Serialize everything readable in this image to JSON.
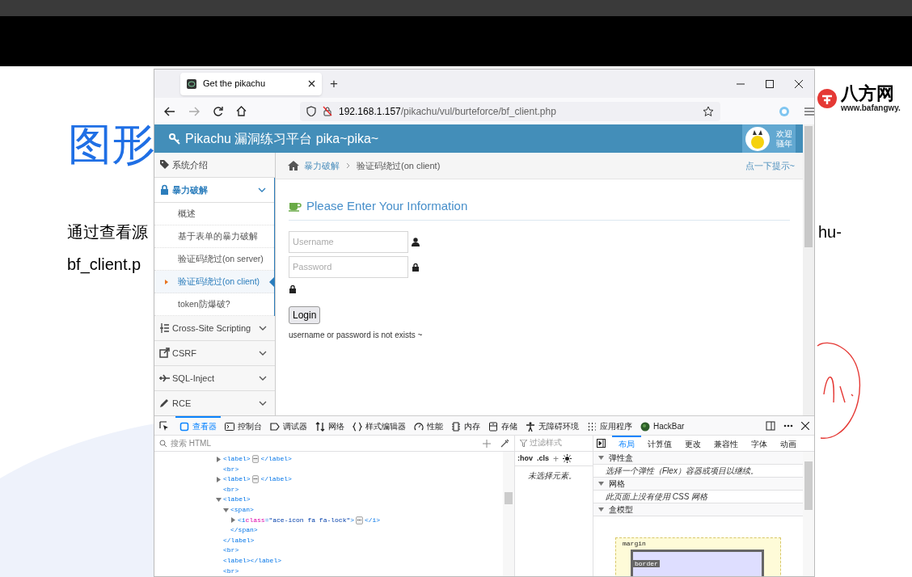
{
  "slide": {
    "title": "图形",
    "line_1": "通过查看源",
    "line_1_end": "hu-",
    "line_2": "bf_client.p",
    "logo": {
      "name": "八方网",
      "url": "www.bafangwy."
    }
  },
  "browser": {
    "tabs": [
      {
        "title": "Get the pikachu",
        "selected": true
      }
    ],
    "new_tab": "+",
    "url_host": "192.168.1.157",
    "url_path": "/pikachu/vul/burteforce/bf_client.php"
  },
  "site": {
    "title": "Pikachu 漏洞练习平台 pika~pika~",
    "welcome": [
      "欢迎",
      "骚年"
    ]
  },
  "sidebar": {
    "items": [
      {
        "label": "系统介绍",
        "selected": false
      },
      {
        "label": "暴力破解",
        "selected": true,
        "expanded": true,
        "children": [
          {
            "label": "概述",
            "selected": false
          },
          {
            "label": "基于表单的暴力破解",
            "selected": false
          },
          {
            "label": "验证码绕过(on server)",
            "selected": false
          },
          {
            "label": "验证码绕过(on client)",
            "selected": true
          },
          {
            "label": "token防爆破?",
            "selected": false
          }
        ]
      },
      {
        "label": "Cross-Site Scripting",
        "selected": false,
        "expanded": false
      },
      {
        "label": "CSRF",
        "selected": false,
        "expanded": false
      },
      {
        "label": "SQL-Inject",
        "selected": false,
        "expanded": false
      },
      {
        "label": "RCE",
        "selected": false,
        "expanded": false
      }
    ]
  },
  "breadcrumb": {
    "link": "暴力破解",
    "current": "验证码绕过(on client)",
    "hint": "点一下提示~"
  },
  "form": {
    "heading": "Please Enter Your Information",
    "username_placeholder": "Username",
    "password_placeholder": "Password",
    "login": "Login",
    "message": "username or password is not exists ~"
  },
  "devtools": {
    "tabs": [
      {
        "label": "查看器",
        "selected": true
      },
      {
        "label": "控制台",
        "selected": false
      },
      {
        "label": "调试器",
        "selected": false
      },
      {
        "label": "网络",
        "selected": false
      },
      {
        "label": "样式编辑器",
        "selected": false
      },
      {
        "label": "性能",
        "selected": false
      },
      {
        "label": "内存",
        "selected": false
      },
      {
        "label": "存储",
        "selected": false
      },
      {
        "label": "无障碍环境",
        "selected": false
      },
      {
        "label": "应用程序",
        "selected": false
      },
      {
        "label": "HackBar",
        "selected": false
      }
    ],
    "search_placeholder": "搜索 HTML",
    "tree": [
      {
        "open": "<label>",
        "ellipsis": "⋯",
        "close": "</label>",
        "expanded": false
      },
      {
        "open": "<br>"
      },
      {
        "open": "<label>",
        "ellipsis": "⋯",
        "close": "</label>",
        "expanded": false
      },
      {
        "open": "<br>"
      },
      {
        "open": "<label>",
        "close": "</label>",
        "expanded": true,
        "children": [
          {
            "open": "<span>",
            "close": "</span>",
            "expanded": true,
            "children": [
              {
                "open": [
                  {
                    "t": "<i ",
                    "kind": "tag"
                  },
                  {
                    "t": "class",
                    "kind": "attr"
                  },
                  {
                    "t": "=",
                    "kind": "tag"
                  },
                  {
                    "t": "\"ace-icon fa fa-lock\"",
                    "kind": "value"
                  },
                  {
                    "t": ">",
                    "kind": "tag"
                  }
                ],
                "ellipsis": "⋯",
                "close": "</i>",
                "expanded": false
              }
            ]
          }
        ]
      },
      {
        "open": "<br>"
      },
      {
        "open": "<label></label>"
      },
      {
        "open": "<br>"
      }
    ],
    "rules": {
      "filter_placeholder": "过滤样式",
      "hov": ":hov",
      "cls": ".cls",
      "add": "+",
      "empty": "未选择元素。"
    },
    "layout_tabs": [
      {
        "label": "布局",
        "selected": true
      },
      {
        "label": "计算值",
        "selected": false
      },
      {
        "label": "更改",
        "selected": false
      },
      {
        "label": "兼容性",
        "selected": false
      },
      {
        "label": "字体",
        "selected": false
      },
      {
        "label": "动画",
        "selected": false
      }
    ],
    "sections": [
      {
        "title": "弹性盒",
        "expanded": true,
        "text": "选择一个弹性（Flex）容器或项目以继续。"
      },
      {
        "title": "网格",
        "expanded": true,
        "text": "此页面上没有使用 CSS 网格"
      },
      {
        "title": "盒模型",
        "expanded": true,
        "box_model": {
          "margin": "margin",
          "border": "border"
        }
      }
    ]
  }
}
